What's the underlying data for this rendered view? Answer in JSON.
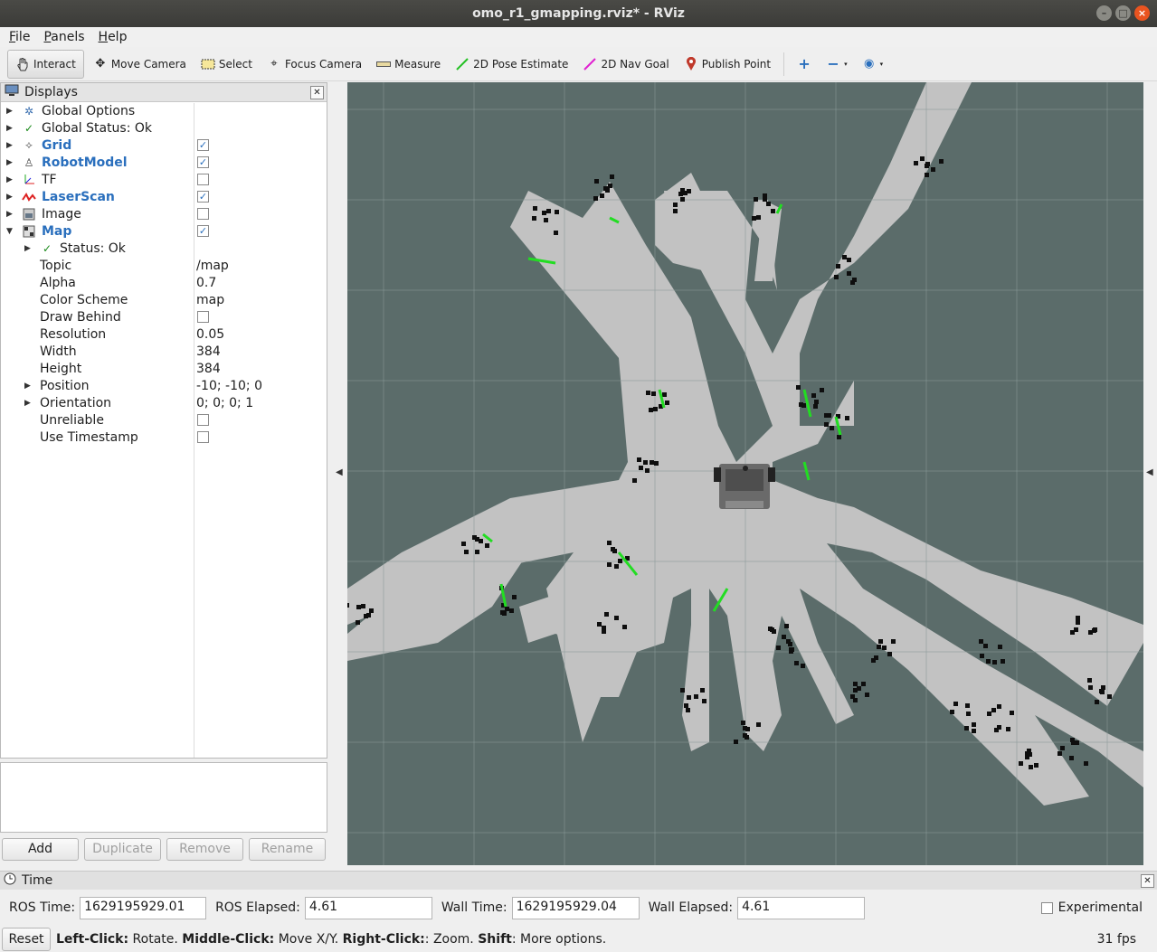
{
  "window": {
    "title": "omo_r1_gmapping.rviz* - RViz"
  },
  "menu": [
    {
      "label": "File",
      "key": "F"
    },
    {
      "label": "Panels",
      "key": "P"
    },
    {
      "label": "Help",
      "key": "H"
    }
  ],
  "toolbar": {
    "interact": "Interact",
    "move_camera": "Move Camera",
    "select": "Select",
    "focus_camera": "Focus Camera",
    "measure": "Measure",
    "pose_estimate": "2D Pose Estimate",
    "nav_goal": "2D Nav Goal",
    "publish_point": "Publish Point"
  },
  "displays": {
    "title": "Displays",
    "rows": [
      {
        "label": "Global Options",
        "icon": "gear-icon"
      },
      {
        "label": "Global Status: Ok",
        "icon": "check-icon"
      },
      {
        "label": "Grid",
        "icon": "grid-icon",
        "checked": true,
        "enabled": true
      },
      {
        "label": "RobotModel",
        "icon": "robot-icon",
        "checked": true,
        "enabled": true
      },
      {
        "label": "TF",
        "icon": "tf-axes-icon",
        "checked": false
      },
      {
        "label": "LaserScan",
        "icon": "laserscan-icon",
        "checked": true,
        "enabled": true
      },
      {
        "label": "Image",
        "icon": "image-icon",
        "checked": false
      },
      {
        "label": "Map",
        "icon": "map-icon",
        "checked": true,
        "enabled": true,
        "expanded": true
      }
    ],
    "map_props": [
      {
        "label": "Status: Ok",
        "value": ""
      },
      {
        "label": "Topic",
        "value": "/map"
      },
      {
        "label": "Alpha",
        "value": "0.7"
      },
      {
        "label": "Color Scheme",
        "value": "map"
      },
      {
        "label": "Draw Behind",
        "checkbox": false
      },
      {
        "label": "Resolution",
        "value": "0.05"
      },
      {
        "label": "Width",
        "value": "384"
      },
      {
        "label": "Height",
        "value": "384"
      },
      {
        "label": "Position",
        "value": "-10; -10; 0"
      },
      {
        "label": "Orientation",
        "value": "0; 0; 0; 1"
      },
      {
        "label": "Unreliable",
        "checkbox": false
      },
      {
        "label": "Use Timestamp",
        "checkbox": false
      }
    ],
    "buttons": {
      "add": "Add",
      "duplicate": "Duplicate",
      "remove": "Remove",
      "rename": "Rename"
    }
  },
  "time": {
    "title": "Time",
    "ros_time_label": "ROS Time:",
    "ros_time": "1629195929.01",
    "ros_elapsed_label": "ROS Elapsed:",
    "ros_elapsed": "4.61",
    "wall_time_label": "Wall Time:",
    "wall_time": "1629195929.04",
    "wall_elapsed_label": "Wall Elapsed:",
    "wall_elapsed": "4.61",
    "experimental": "Experimental"
  },
  "status": {
    "reset": "Reset",
    "hint_parts": [
      {
        "b": "Left-Click:",
        "t": " Rotate. "
      },
      {
        "b": "Middle-Click:",
        "t": " Move X/Y. "
      },
      {
        "b": "Right-Click:",
        "t": ": Zoom. "
      },
      {
        "b": "Shift",
        "t": ": More options."
      }
    ],
    "fps": "31 fps"
  },
  "colors": {
    "map_unknown": "#5b6c6a",
    "map_free": "#c2c2c2",
    "map_occupied": "#0e0e0e",
    "laser": "#22dd22",
    "grid": "#8a9a98",
    "accent": "#2a6fbd"
  }
}
